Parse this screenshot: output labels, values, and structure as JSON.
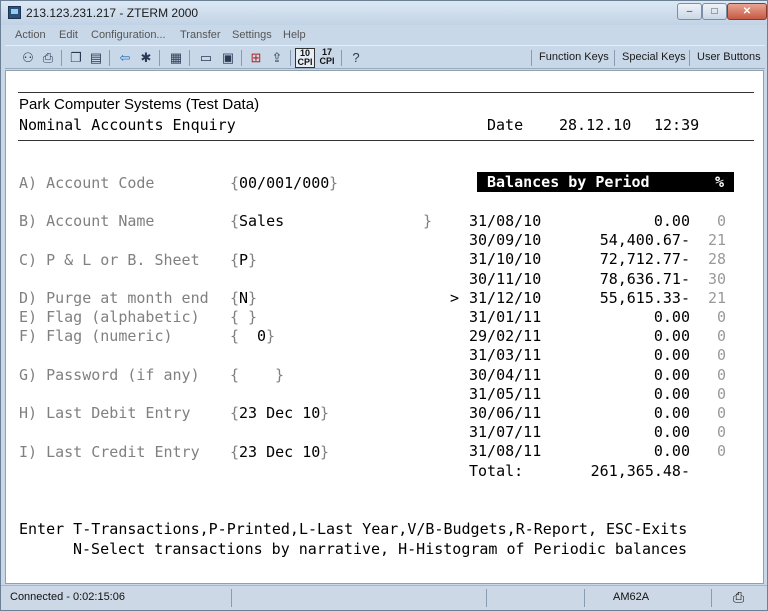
{
  "window": {
    "title": "213.123.231.217 - ZTERM 2000",
    "min": "–",
    "max": "□",
    "close": "✕"
  },
  "menu": [
    "Action",
    "Edit",
    "Configuration...",
    "Transfer",
    "Settings",
    "Help"
  ],
  "toolbar": {
    "icons": [
      "connect-icon",
      "print-icon",
      "copy-icon",
      "paste-icon",
      "back-icon",
      "run-icon",
      "properties-icon",
      "new-icon",
      "open-icon",
      "capture-icon",
      "upload-icon",
      "help-icon"
    ],
    "cpi10": "10",
    "cpi17": "17",
    "cpi_label": "CPI",
    "function_keys": "Function Keys",
    "special_keys": "Special Keys",
    "user_buttons": "User Buttons"
  },
  "terminal": {
    "company": "Park Computer Systems (Test Data)",
    "screen_title": "Nominal Accounts Enquiry",
    "date_label": "Date",
    "date": "28.12.10",
    "time": "12:39",
    "fields": [
      {
        "label": "A) Account Code",
        "value": "00/001/000",
        "open": "{",
        "close": "}"
      },
      {
        "label": "B) Account Name",
        "value": "Sales",
        "open": "{",
        "close": "}"
      },
      {
        "label": "C) P & L or B. Sheet",
        "value": "P",
        "open": "{",
        "close": "}"
      },
      {
        "label": "D) Purge at month end",
        "value": "N",
        "open": "{",
        "close": "}"
      },
      {
        "label": "E) Flag (alphabetic)",
        "value": " ",
        "open": "{",
        "close": "}"
      },
      {
        "label": "F) Flag (numeric)",
        "value": "  0",
        "open": "{",
        "close": "}"
      },
      {
        "label": "G) Password (if any)",
        "value": "    ",
        "open": "{",
        "close": "}"
      },
      {
        "label": "H) Last Debit Entry",
        "value": "23 Dec 10",
        "open": "{",
        "close": "}"
      },
      {
        "label": "I) Last Credit Entry",
        "value": "23 Dec 10",
        "open": "{",
        "close": "}"
      }
    ],
    "balances_title": "Balances by Period",
    "balances_pct": "%",
    "current_marker": ">",
    "balances": [
      {
        "date": "31/08/10",
        "amount": "0.00",
        "pct": "0"
      },
      {
        "date": "30/09/10",
        "amount": "54,400.67-",
        "pct": "21"
      },
      {
        "date": "31/10/10",
        "amount": "72,712.77-",
        "pct": "28"
      },
      {
        "date": "30/11/10",
        "amount": "78,636.71-",
        "pct": "30"
      },
      {
        "date": "31/12/10",
        "amount": "55,615.33-",
        "pct": "21"
      },
      {
        "date": "31/01/11",
        "amount": "0.00",
        "pct": "0"
      },
      {
        "date": "29/02/11",
        "amount": "0.00",
        "pct": "0"
      },
      {
        "date": "31/03/11",
        "amount": "0.00",
        "pct": "0"
      },
      {
        "date": "30/04/11",
        "amount": "0.00",
        "pct": "0"
      },
      {
        "date": "31/05/11",
        "amount": "0.00",
        "pct": "0"
      },
      {
        "date": "30/06/11",
        "amount": "0.00",
        "pct": "0"
      },
      {
        "date": "31/07/11",
        "amount": "0.00",
        "pct": "0"
      },
      {
        "date": "31/08/11",
        "amount": "0.00",
        "pct": "0"
      }
    ],
    "total_label": "Total:",
    "total": "261,365.48-",
    "help_line1": "Enter T-Transactions,P-Printed,L-Last Year,V/B-Budgets,R-Report, ESC-Exits",
    "help_line2": "N-Select transactions by narrative, H-Histogram of Periodic balances"
  },
  "status": {
    "connected": "Connected - 0:02:15:06",
    "terminal_type": "AM62A",
    "print_icon": "printer-icon"
  }
}
